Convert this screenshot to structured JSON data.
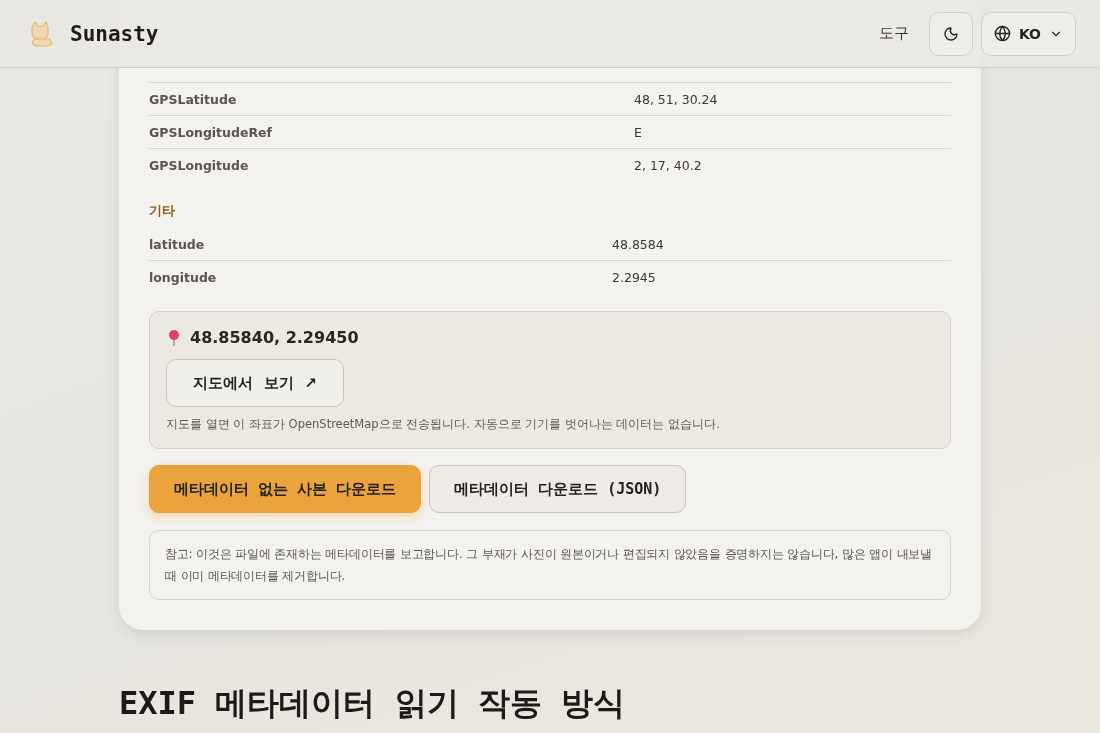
{
  "header": {
    "brand": "Sunasty",
    "nav_link": "도구",
    "language": "KO"
  },
  "sections": [
    {
      "rows": [
        {
          "key": "GPSLatitude",
          "value": "48, 51, 30.24"
        },
        {
          "key": "GPSLongitudeRef",
          "value": "E"
        },
        {
          "key": "GPSLongitude",
          "value": "2, 17, 40.2"
        }
      ]
    },
    {
      "title": "기타",
      "rows": [
        {
          "key": "latitude",
          "value": "48.8584"
        },
        {
          "key": "longitude",
          "value": "2.2945"
        }
      ]
    }
  ],
  "location": {
    "coordinates": "48.85840, 2.29450",
    "map_button": "지도에서  보기  ↗",
    "privacy_note": "지도를 열면 이 좌표가 OpenStreetMap으로 전송됩니다. 자동으로 기기를 벗어나는 데이터는 없습니다."
  },
  "actions": [
    {
      "label": "메타데이터 없는 사본 다운로드",
      "primary": true
    },
    {
      "label": "메타데이터 다운로드 (JSON)",
      "primary": false
    }
  ],
  "note": "참고: 이것은 파일에 존재하는 메타데이터를 보고합니다. 그 부재가 사진이 원본이거나 편집되지 않았음을 증명하지는 않습니다, 많은 앱이 내보낼 때 이미 메타데이터를 제거합니다.",
  "heading": "EXIF 메타데이터 읽기 작동 방식"
}
